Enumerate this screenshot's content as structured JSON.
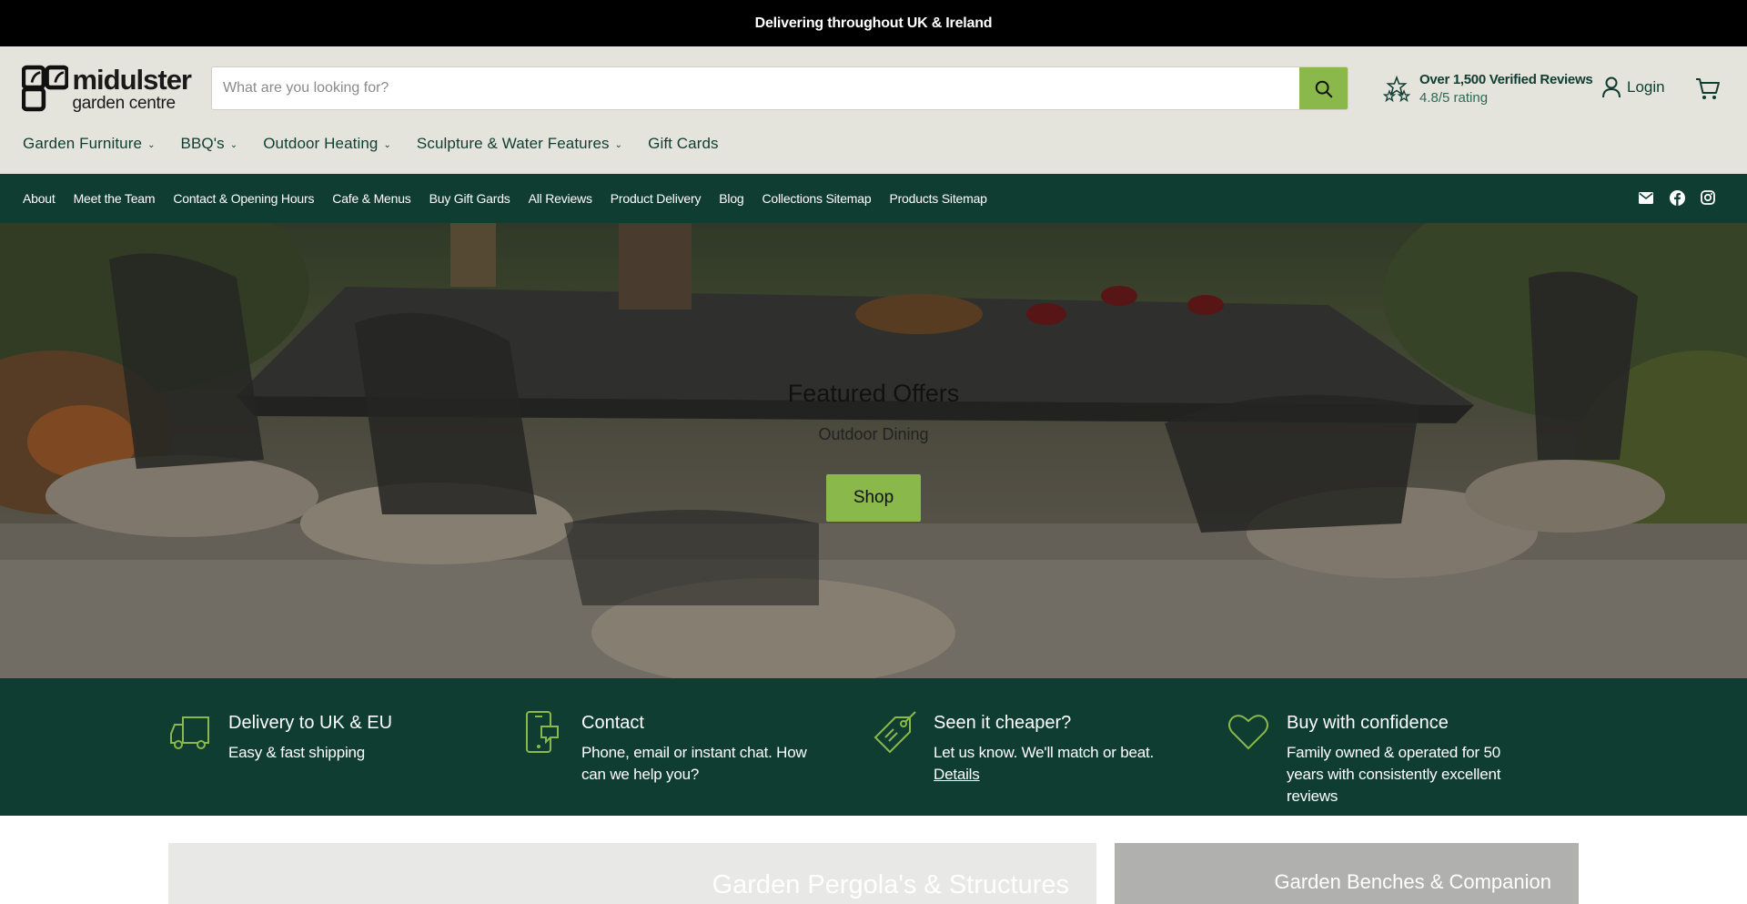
{
  "announcement": {
    "text": "Delivering throughout UK & Ireland"
  },
  "brand": {
    "line1": "midulster",
    "line2": "garden centre"
  },
  "search": {
    "placeholder": "What are you looking for?"
  },
  "reviews": {
    "title": "Over 1,500 Verified Reviews",
    "rating": "4.8/5 rating"
  },
  "account": {
    "login_label": "Login"
  },
  "main_nav": [
    {
      "label": "Garden Furniture",
      "has_dropdown": true
    },
    {
      "label": "BBQ's",
      "has_dropdown": true
    },
    {
      "label": "Outdoor Heating",
      "has_dropdown": true
    },
    {
      "label": "Sculpture & Water Features",
      "has_dropdown": true
    },
    {
      "label": "Gift Cards",
      "has_dropdown": false
    }
  ],
  "sub_nav": [
    "About",
    "Meet the Team",
    "Contact & Opening Hours",
    "Cafe & Menus",
    "Buy Gift Gards",
    "All Reviews",
    "Product Delivery",
    "Blog",
    "Collections Sitemap",
    "Products Sitemap"
  ],
  "social": [
    "email-icon",
    "facebook-icon",
    "instagram-icon"
  ],
  "hero": {
    "title": "Featured Offers",
    "subtitle": "Outdoor Dining",
    "button_label": "Shop"
  },
  "features": [
    {
      "icon": "truck-icon",
      "title": "Delivery to UK & EU",
      "desc": "Easy & fast shipping",
      "link": ""
    },
    {
      "icon": "mobile-chat-icon",
      "title": "Contact",
      "desc": "Phone, email or instant chat. How can we help you?",
      "link": ""
    },
    {
      "icon": "price-tag-icon",
      "title": "Seen it cheaper?",
      "desc": "Let us know. We'll match or beat.",
      "link": "Details"
    },
    {
      "icon": "heart-icon",
      "title": "Buy with confidence",
      "desc": "Family owned & operated for 50 years with consistently excellent reviews",
      "link": ""
    }
  ],
  "collections": [
    {
      "title": "Garden Pergola's & Structures"
    },
    {
      "title": "Garden Benches & Companion"
    }
  ],
  "colors": {
    "dark_green": "#0f3d31",
    "accent_green": "#8ab84a",
    "header_bg": "#e4e4dc"
  }
}
